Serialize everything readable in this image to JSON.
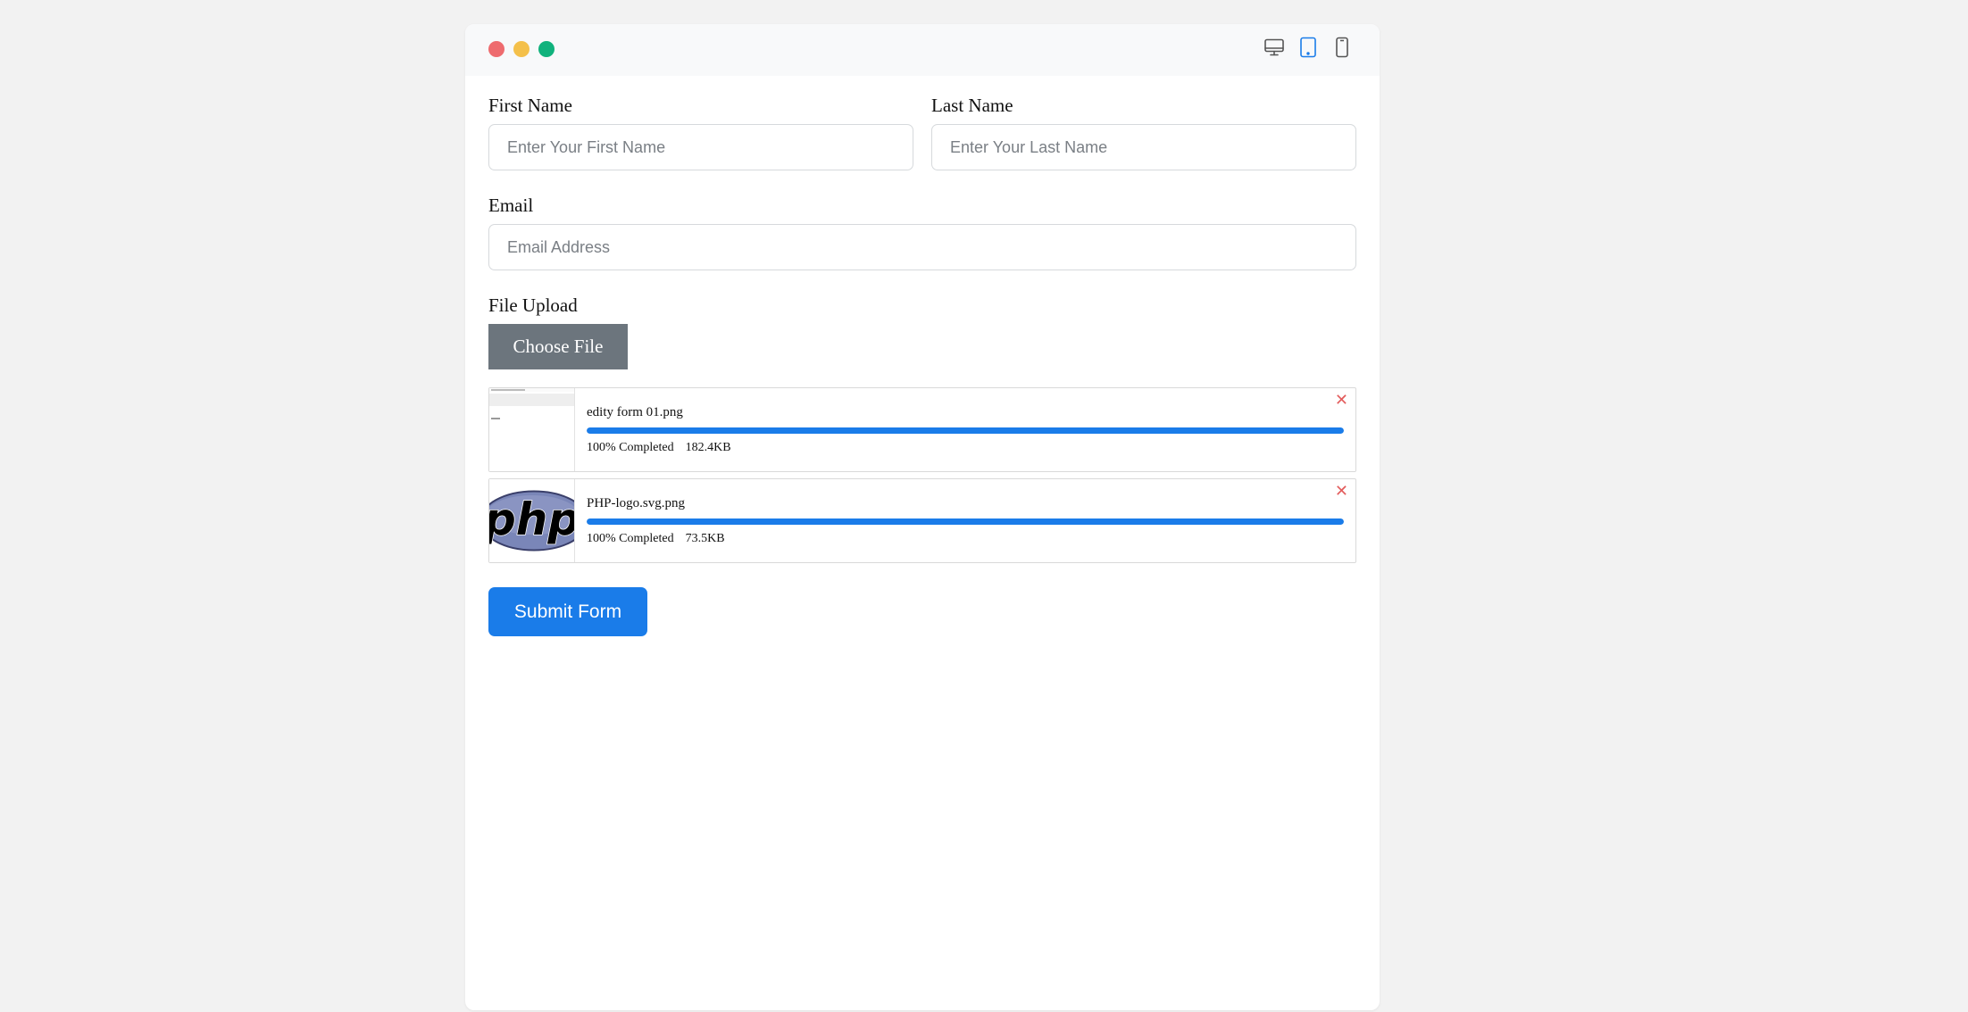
{
  "form": {
    "first_name": {
      "label": "First Name",
      "placeholder": "Enter Your First Name",
      "value": ""
    },
    "last_name": {
      "label": "Last Name",
      "placeholder": "Enter Your Last Name",
      "value": ""
    },
    "email": {
      "label": "Email",
      "placeholder": "Email Address",
      "value": ""
    },
    "file_upload": {
      "label": "File Upload",
      "button_label": "Choose File"
    },
    "files": [
      {
        "name": "edity form 01.png",
        "progress": 100,
        "status": "100% Completed",
        "size": "182.4KB",
        "thumbnail": "form-screenshot-thumbnail"
      },
      {
        "name": "PHP-logo.svg.png",
        "progress": 100,
        "status": "100% Completed",
        "size": "73.5KB",
        "thumbnail": "php-logo-thumbnail",
        "thumbnail_text": "php"
      }
    ],
    "remove_glyph": "✕",
    "submit_label": "Submit Form"
  },
  "window": {
    "controls": [
      "close",
      "minimize",
      "maximize"
    ],
    "device_views": [
      "desktop",
      "tablet",
      "mobile"
    ],
    "active_device": "tablet"
  },
  "colors": {
    "accent": "#1a7ce9",
    "secondary": "#6c757d",
    "danger": "#e35d5d",
    "dot_red": "#ee6b6e",
    "dot_yellow": "#f4c04a",
    "dot_green": "#10b27c"
  }
}
